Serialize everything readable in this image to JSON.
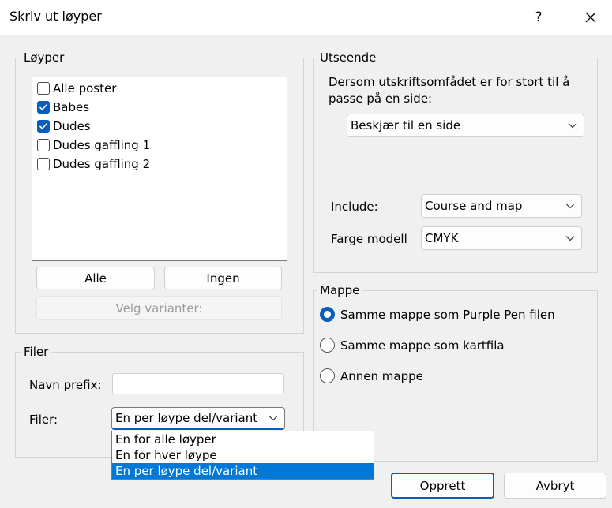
{
  "window": {
    "title": "Skriv ut løyper",
    "help_label": "?"
  },
  "courses": {
    "group_title": "Løyper",
    "items": [
      {
        "label": "Alle poster",
        "checked": false
      },
      {
        "label": "Babes",
        "checked": true
      },
      {
        "label": "Dudes",
        "checked": true
      },
      {
        "label": "Dudes gaffling 1",
        "checked": false
      },
      {
        "label": "Dudes gaffling 2",
        "checked": false
      }
    ],
    "all_button": "Alle",
    "none_button": "Ingen",
    "variants_button": "Velg varianter:"
  },
  "files": {
    "group_title": "Filer",
    "name_prefix_label": "Navn prefix:",
    "name_prefix_value": "",
    "files_label": "Filer:",
    "files_selected": "En per løype del/variant",
    "files_options": [
      "En for alle løyper",
      "En for hver løype",
      "En per løype del/variant"
    ]
  },
  "appearance": {
    "group_title": "Utseende",
    "description_line1": "Dersom utskriftsomfådet er for stort til å",
    "description_line2": "passe på en side:",
    "page_fit_selected": "Beskjær til en side",
    "include_label": "Include:",
    "include_selected": "Course and map",
    "color_model_label": "Farge modell",
    "color_model_selected": "CMYK"
  },
  "folder": {
    "group_title": "Mappe",
    "options": [
      {
        "label": "Samme mappe som Purple Pen filen",
        "selected": true
      },
      {
        "label": "Samme mappe som kartfila",
        "selected": false
      },
      {
        "label": "Annen mappe",
        "selected": false
      }
    ]
  },
  "footer": {
    "create_button": "Opprett",
    "cancel_button": "Avbryt"
  },
  "colors": {
    "accent": "#0a5cbd",
    "selection": "#0078d7"
  }
}
